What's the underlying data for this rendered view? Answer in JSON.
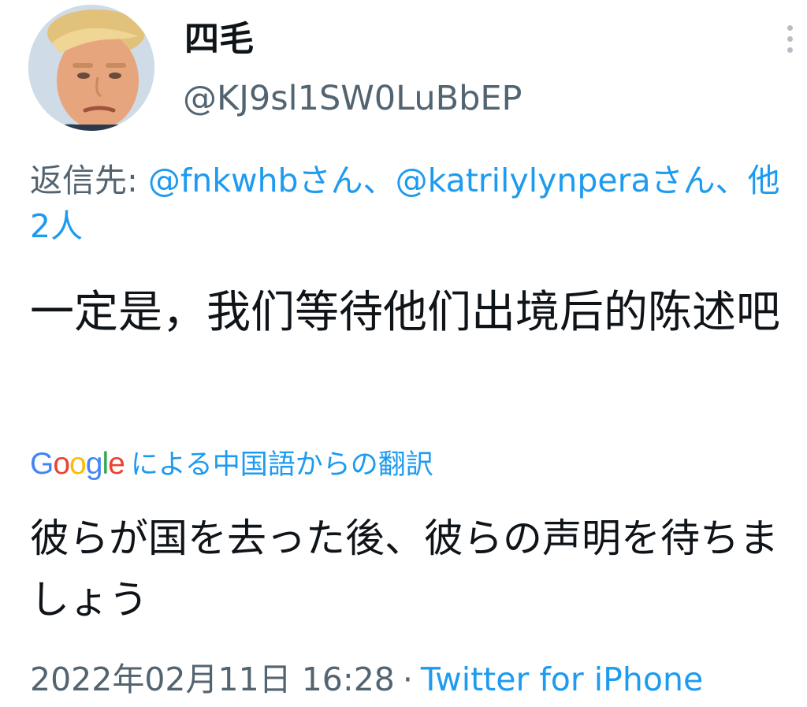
{
  "author": {
    "display_name": "四毛",
    "handle": "@KJ9sl1SW0LuBbEP",
    "avatar_icon": "user-avatar"
  },
  "reply": {
    "prefix": "返信先: ",
    "mention_1": "@fnkwhbさん",
    "separator_1": "、",
    "mention_2": "@katrilylynperaさん",
    "separator_2": "、",
    "others": "他2人"
  },
  "tweet": {
    "text": "一定是，我们等待他们出境后的陈述吧"
  },
  "translation": {
    "logo_letters": [
      "G",
      "o",
      "o",
      "g",
      "l",
      "e"
    ],
    "label": "による中国語からの翻訳",
    "text": "彼らが国を去った後、彼らの声明を待ちましょう"
  },
  "meta": {
    "timestamp": "2022年02月11日 16:28",
    "separator": "·",
    "source": "Twitter for iPhone"
  },
  "colors": {
    "link": "#1d9bf0",
    "secondary": "#536471",
    "primary": "#0f1419",
    "google_blue": "#4285f4",
    "google_red": "#ea4335",
    "google_yellow": "#fbbc05",
    "google_green": "#34a853"
  }
}
